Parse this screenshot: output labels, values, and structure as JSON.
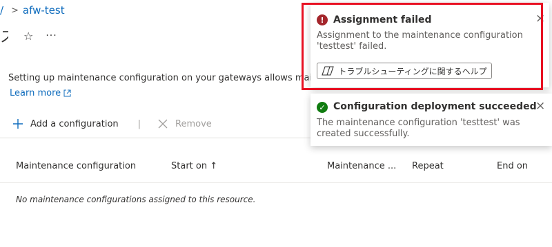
{
  "breadcrumb": {
    "prev": "/",
    "separator": ">",
    "current": "afw-test"
  },
  "page": {
    "title": "ス",
    "star": "☆",
    "more": "···"
  },
  "description": "Setting up maintenance configuration on your gateways allows maintenance",
  "learn_more": "Learn more",
  "toolbar": {
    "add_label": "Add a configuration",
    "separator": "|",
    "remove_label": "Remove"
  },
  "table": {
    "headers": [
      "Maintenance configuration",
      "Start on ↑",
      "Maintenance ...",
      "Repeat",
      "End on"
    ],
    "empty_message": "No maintenance configurations assigned to this resource."
  },
  "notifications": [
    {
      "status": "error",
      "icon": "!",
      "title": "Assignment failed",
      "body": "Assignment to the maintenance configuration 'testtest' failed.",
      "action": "トラブルシューティングに関するヘルプ",
      "close": "×",
      "color": "#a4262c"
    },
    {
      "status": "success",
      "icon": "✓",
      "title": "Configuration deployment succeeded",
      "body": "The maintenance configuration 'testtest' was created successfully.",
      "close": "×",
      "color": "#107c10"
    }
  ],
  "colors": {
    "accent": "#0f6cbd",
    "highlight": "#e81123"
  }
}
